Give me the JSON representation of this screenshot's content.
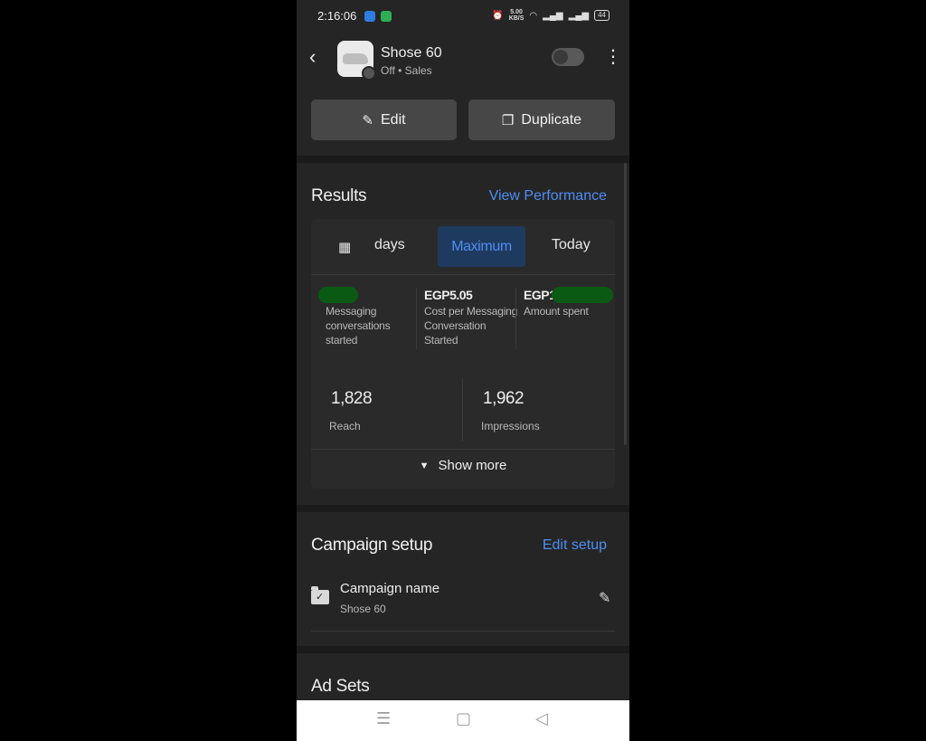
{
  "status_bar": {
    "time": "2:16:06",
    "net_speed": "5.00",
    "net_unit": "KB/S",
    "battery": "44"
  },
  "header": {
    "title": "Shose 60",
    "subtitle": "Off • Sales",
    "edit_label": "Edit",
    "duplicate_label": "Duplicate"
  },
  "results": {
    "title": "Results",
    "link": "View Performance",
    "ranges": {
      "days": "days",
      "maximum": "Maximum",
      "today": "Today",
      "selected": "Maximum"
    },
    "metrics": [
      {
        "value": "",
        "label": "Messaging conversations started"
      },
      {
        "value": "EGP5.05",
        "label": "Cost per Messaging Conversation Started"
      },
      {
        "value": "EGP1",
        "label": "Amount spent"
      }
    ],
    "reach": {
      "value": "1,828",
      "label": "Reach"
    },
    "impressions": {
      "value": "1,962",
      "label": "Impressions"
    },
    "show_more": "Show more"
  },
  "campaign_setup": {
    "title": "Campaign setup",
    "link": "Edit setup",
    "name_label": "Campaign name",
    "name_value": "Shose 60"
  },
  "ad_sets": {
    "title": "Ad Sets"
  },
  "colors": {
    "accent": "#4e8ef3",
    "selected_bg": "#1f3a5f",
    "redaction": "#0b5a13"
  },
  "icons": [
    "back-icon",
    "more-icon",
    "pencil-icon",
    "copy-icon",
    "calendar-icon",
    "chevron-down-icon",
    "folder-check-icon",
    "menu-icon",
    "home-icon",
    "back-triangle-icon"
  ]
}
